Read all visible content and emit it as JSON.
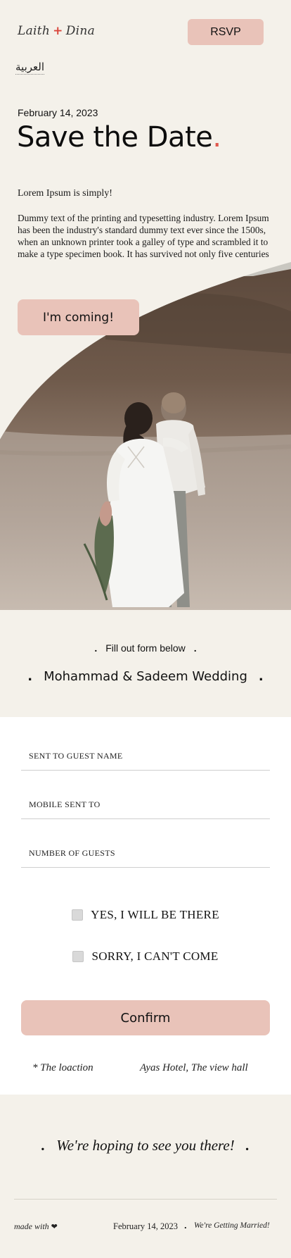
{
  "header": {
    "logo_left": "Laith",
    "logo_plus": "+",
    "logo_right": "Dina",
    "rsvp_label": "RSVP",
    "language_link": "العربية"
  },
  "hero": {
    "date": "February 14, 2023",
    "title": "Save the Date",
    "title_dot": ".",
    "lead": "Lorem Ipsum is simply!",
    "description": "Dummy text of the printing and typesetting industry. Lorem Ipsum has been the industry's standard dummy text ever since the 1500s, when an unknown printer took a galley of type and scrambled it to make a type specimen book. It has survived not only five centuries",
    "cta_label": "I'm coming!"
  },
  "fill_section": {
    "instruction": "Fill out form below",
    "wedding_name": "Mohammad & Sadeem Wedding",
    "separator": "."
  },
  "form": {
    "fields": [
      {
        "placeholder": "SENT TO GUEST NAME",
        "value": ""
      },
      {
        "placeholder": "MOBILE SENT TO",
        "value": ""
      },
      {
        "placeholder": "NUMBER OF GUESTS",
        "value": ""
      }
    ],
    "options": [
      {
        "label": "YES, I WILL BE THERE",
        "checked": false
      },
      {
        "label": "SORRY, I CAN'T COME",
        "checked": false
      }
    ],
    "confirm_label": "Confirm",
    "location_label": "* The loaction",
    "location_value": "Ayas Hotel, The view hall"
  },
  "closing": {
    "message": "We're hoping to see you there!",
    "separator": "."
  },
  "footer": {
    "made_with": "made with",
    "heart": "❤",
    "date": "February 14, 2023",
    "dot": ".",
    "tagline": "We're Getting Married!"
  },
  "colors": {
    "background": "#f4f1ea",
    "accent_button": "#e9c3b9",
    "accent_red": "#e0584d",
    "form_background": "#ffffff"
  },
  "icons": [
    "heart-icon",
    "checkbox-icon"
  ]
}
